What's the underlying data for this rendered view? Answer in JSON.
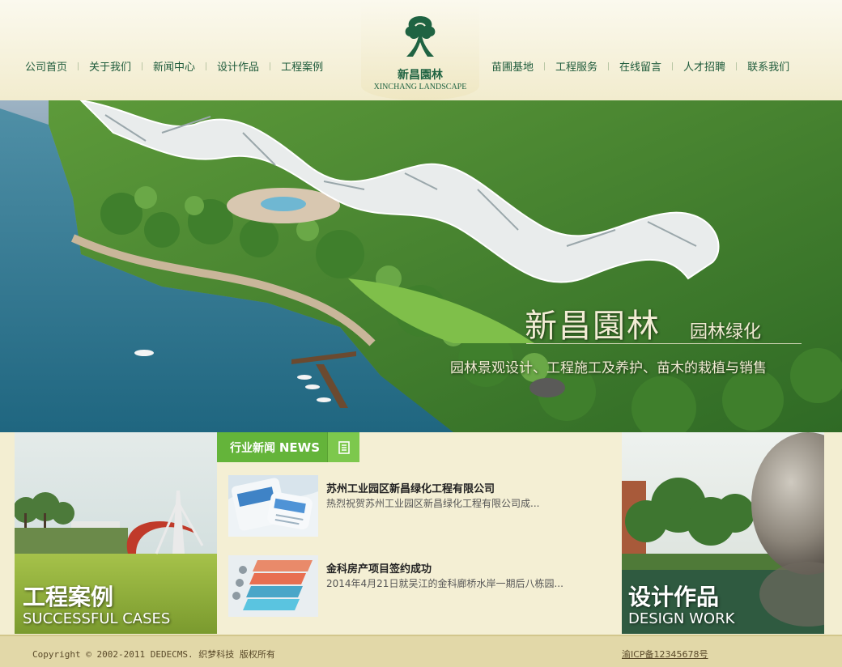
{
  "nav": {
    "left": [
      "公司首页",
      "关于我们",
      "新闻中心",
      "设计作品",
      "工程案例"
    ],
    "right": [
      "苗圃基地",
      "工程服务",
      "在线留言",
      "人才招聘",
      "联系我们"
    ]
  },
  "logo": {
    "cn": "新昌園林",
    "en": "XINCHANG LANDSCAPE",
    "icon": "tree-icon",
    "color": "#1f6342"
  },
  "banner": {
    "title": "新昌園林",
    "subtitle": "园林绿化",
    "description": "园林景观设计、工程施工及养护、苗木的栽植与销售"
  },
  "features": {
    "case": {
      "cn": "工程案例",
      "en": "SUCCESSFUL CASES"
    },
    "design": {
      "cn": "设计作品",
      "en": "DESIGN WORK"
    }
  },
  "news": {
    "title_cn": "行业新闻",
    "title_en": "NEWS",
    "more_icon": "document-icon",
    "items": [
      {
        "headline": "苏州工业园区新昌绿化工程有限公司",
        "summary": "热烈祝贺苏州工业园区新昌绿化工程有限公司成..."
      },
      {
        "headline": "金科房产项目签约成功",
        "summary": "2014年4月21日就吴江的金科廊桥水岸一期后八栋园..."
      }
    ]
  },
  "footer": {
    "copyright": "Copyright © 2002-2011 DEDECMS. 织梦科技 版权所有",
    "icp": "渝ICP备12345678号"
  },
  "colors": {
    "accent": "#64b43a",
    "brand": "#1f6342",
    "nav_text": "#1d5a3a",
    "footer_bg": "#e2d8a8"
  }
}
